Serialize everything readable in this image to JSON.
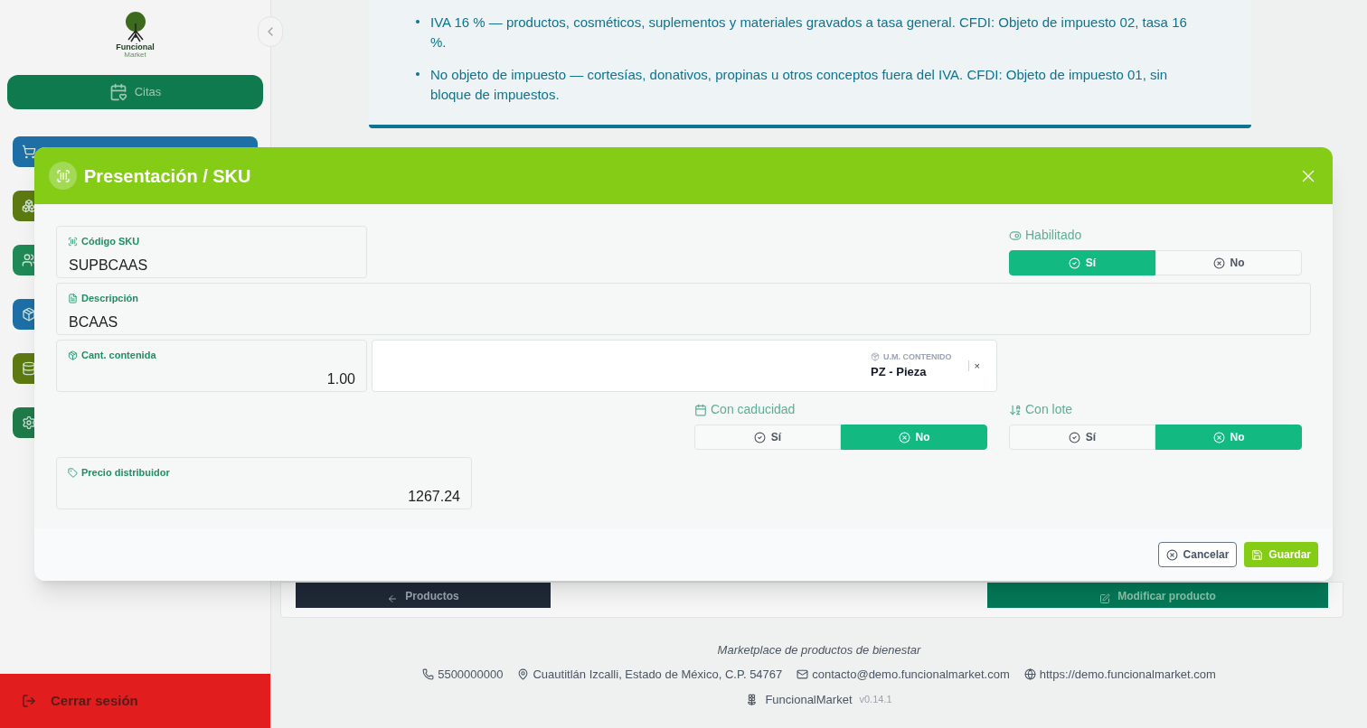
{
  "sidebar": {
    "logo": {
      "name": "Funcional",
      "sub": "Market"
    },
    "appointments_button": "Citas",
    "menu_items": [
      {
        "kind": "cart",
        "color": "#1d6fa5"
      },
      {
        "kind": "boxes",
        "color": "#5d7a12"
      },
      {
        "kind": "users",
        "color": "#1f8a55"
      },
      {
        "kind": "box",
        "color": "#1d6fa5"
      },
      {
        "kind": "database",
        "color": "#5d7a12"
      },
      {
        "kind": "gear",
        "color": "#1f7a4a"
      }
    ],
    "logout": "Cerrar sesión"
  },
  "tax_notes": [
    "IVA 16 % — productos, cosméticos, suplementos y materiales gravados a tasa general. CFDI: Objeto de impuesto 02, tasa 16 %.",
    "No objeto de impuesto — cortesías, donativos, propinas u otros conceptos fuera del IVA. CFDI: Objeto de impuesto 01, sin bloque de impuestos."
  ],
  "page_actions": [
    {
      "kind": "back",
      "label": "Productos"
    },
    {
      "kind": "edit",
      "label": "Modificar producto"
    }
  ],
  "footer": {
    "tagline": "Marketplace de productos de bienestar",
    "contacts": [
      {
        "kind": "phone",
        "text": "5500000000"
      },
      {
        "kind": "pin",
        "text": "Cuautitlán Izcalli, Estado de México, C.P. 54767"
      },
      {
        "kind": "mail",
        "text": "contacto@demo.funcionalmarket.com"
      },
      {
        "kind": "globe",
        "text": "https://demo.funcionalmarket.com"
      }
    ],
    "brand": "FuncionalMarket",
    "version": "v0.14.1"
  },
  "modal": {
    "title": "Presentación / SKU",
    "sku": {
      "label": "Código SKU",
      "value": "SUPBCAAS"
    },
    "enabled": {
      "label": "Habilitado",
      "options": [
        {
          "label": "Sí",
          "selected": true
        },
        {
          "label": "No",
          "selected": false
        }
      ]
    },
    "description": {
      "label": "Descripción",
      "value": "BCAAS"
    },
    "quantity": {
      "label": "Cant. contenida",
      "value": "1.00"
    },
    "unit": {
      "label": "U.M. CONTENIDO",
      "value": "PZ - Pieza",
      "clear": "×"
    },
    "expiry": {
      "label": "Con caducidad",
      "options": [
        {
          "label": "Sí",
          "selected": false
        },
        {
          "label": "No",
          "selected": true
        }
      ]
    },
    "batch": {
      "label": "Con lote",
      "options": [
        {
          "label": "Sí",
          "selected": false
        },
        {
          "label": "No",
          "selected": true
        }
      ]
    },
    "price": {
      "label": "Precio distribuidor",
      "value": "1267.24"
    },
    "buttons": [
      {
        "kind": "cancel",
        "label": "Cancelar"
      },
      {
        "kind": "save",
        "label": "Guardar"
      }
    ]
  }
}
